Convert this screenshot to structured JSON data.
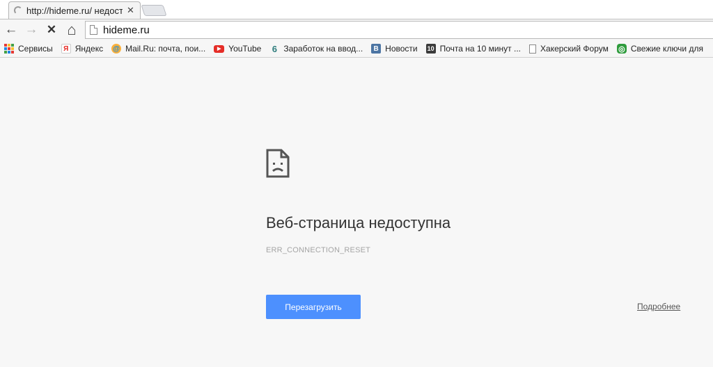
{
  "tab": {
    "title": "http://hideme.ru/ недоступ",
    "close_symbol": "✕"
  },
  "toolbar": {
    "back_symbol": "←",
    "forward_symbol": "→",
    "stop_symbol": "✕",
    "home_symbol": "⌂",
    "url": "hideme.ru"
  },
  "bookmarks": [
    {
      "label": "Сервисы",
      "icon": "apps-grid-icon"
    },
    {
      "label": "Яндекс",
      "icon": "yandex-icon",
      "glyph": "Я",
      "color": "#e52620"
    },
    {
      "label": "Mail.Ru: почта, пои...",
      "icon": "mailru-icon",
      "glyph": "@",
      "color": "#168de2"
    },
    {
      "label": "YouTube",
      "icon": "youtube-icon",
      "glyph": "▶",
      "color": "#e52d27"
    },
    {
      "label": "Заработок на ввод...",
      "icon": "earnings-icon",
      "glyph": "6",
      "color": "#3a8f8f"
    },
    {
      "label": "Новости",
      "icon": "vk-icon",
      "glyph": "В",
      "color": "#4c75a3"
    },
    {
      "label": "Почта на 10 минут ...",
      "icon": "tenminute-mail-icon",
      "glyph": "10",
      "color": "#3b3b3b"
    },
    {
      "label": "Хакерский Форум",
      "icon": "page-icon",
      "glyph": "",
      "color": "#ffffff"
    },
    {
      "label": "Свежие ключи для",
      "icon": "fresh-keys-icon",
      "glyph": "◎",
      "color": "#2e9b3c"
    }
  ],
  "error": {
    "heading": "Веб-страница недоступна",
    "code": "ERR_CONNECTION_RESET",
    "reload_label": "Перезагрузить",
    "details_label": "Подробнее"
  },
  "colors": {
    "reload_button": "#4d90fe",
    "page_background": "#f7f7f7"
  }
}
